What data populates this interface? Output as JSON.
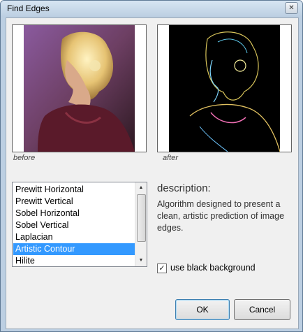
{
  "window": {
    "title": "Find Edges",
    "close_glyph": "✕"
  },
  "previews": {
    "before_caption": "before",
    "after_caption": "after"
  },
  "algorithms": {
    "items": [
      "Prewitt Horizontal",
      "Prewitt Vertical",
      "Sobel Horizontal",
      "Sobel Vertical",
      "Laplacian",
      "Artistic Contour",
      "Hilite"
    ],
    "selected": "Artistic Contour"
  },
  "description": {
    "heading": "description:",
    "text": "Algorithm designed to present a clean, artistic prediction of image edges."
  },
  "options": {
    "black_background_label": "use black background",
    "black_background_checked": true,
    "check_glyph": "✓"
  },
  "buttons": {
    "ok": "OK",
    "cancel": "Cancel"
  }
}
